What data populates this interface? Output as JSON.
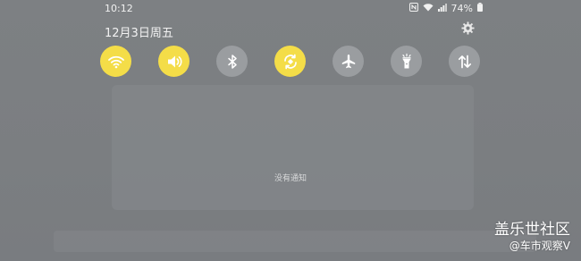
{
  "status_bar": {
    "time": "10:12",
    "nfc_icon": "nfc-icon",
    "wifi_icon": "wifi-status-icon",
    "signal_icon": "signal-icon",
    "battery_percent": "74%",
    "battery_icon": "battery-icon"
  },
  "header": {
    "date": "12月3日周五",
    "settings_icon": "gear-icon"
  },
  "quick_toggles": [
    {
      "name": "wifi",
      "icon": "wifi-icon",
      "state": "on"
    },
    {
      "name": "sound",
      "icon": "volume-icon",
      "state": "on"
    },
    {
      "name": "bluetooth",
      "icon": "bluetooth-icon",
      "state": "off"
    },
    {
      "name": "auto-rotate",
      "icon": "rotate-icon",
      "state": "on"
    },
    {
      "name": "airplane-mode",
      "icon": "airplane-icon",
      "state": "off"
    },
    {
      "name": "flashlight",
      "icon": "flashlight-icon",
      "state": "off"
    },
    {
      "name": "mobile-data",
      "icon": "data-transfer-icon",
      "state": "off"
    }
  ],
  "notifications": {
    "empty_text": "没有通知"
  },
  "watermark": {
    "title": "盖乐世社区",
    "subtitle": "@车市观察V"
  },
  "colors": {
    "toggle_on": "#f4dd48",
    "toggle_off": "#9a9da0",
    "background": "#7b7e81"
  }
}
